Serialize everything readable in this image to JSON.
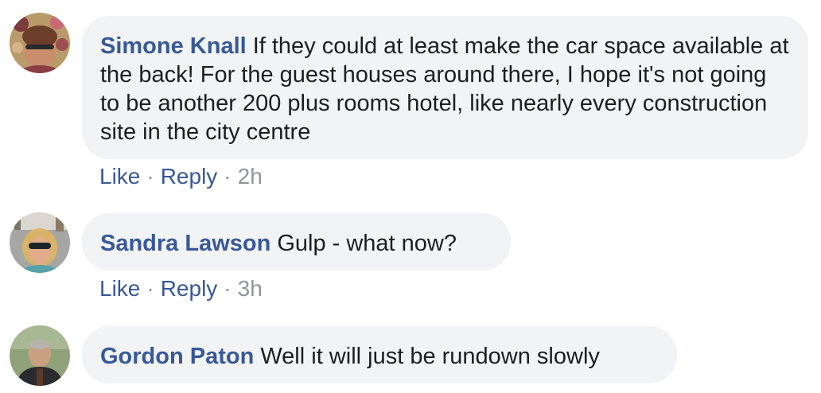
{
  "comments": [
    {
      "author": "Simone Knall",
      "text": "If they could at least make the car space available at the back! For the guest houses around there, I hope it's not going to be another 200 plus rooms hotel, like nearly every construction site in the city centre",
      "like_label": "Like",
      "reply_label": "Reply",
      "separator": "·",
      "time": "2h"
    },
    {
      "author": "Sandra Lawson",
      "text": "Gulp - what now?",
      "like_label": "Like",
      "reply_label": "Reply",
      "separator": "·",
      "time": "3h"
    },
    {
      "author": "Gordon Paton",
      "text": "Well it will just be rundown slowly"
    }
  ],
  "colors": {
    "author_link": "#385898",
    "bubble_bg": "#f2f3f5",
    "text": "#1c1e21",
    "meta": "#90949c"
  }
}
